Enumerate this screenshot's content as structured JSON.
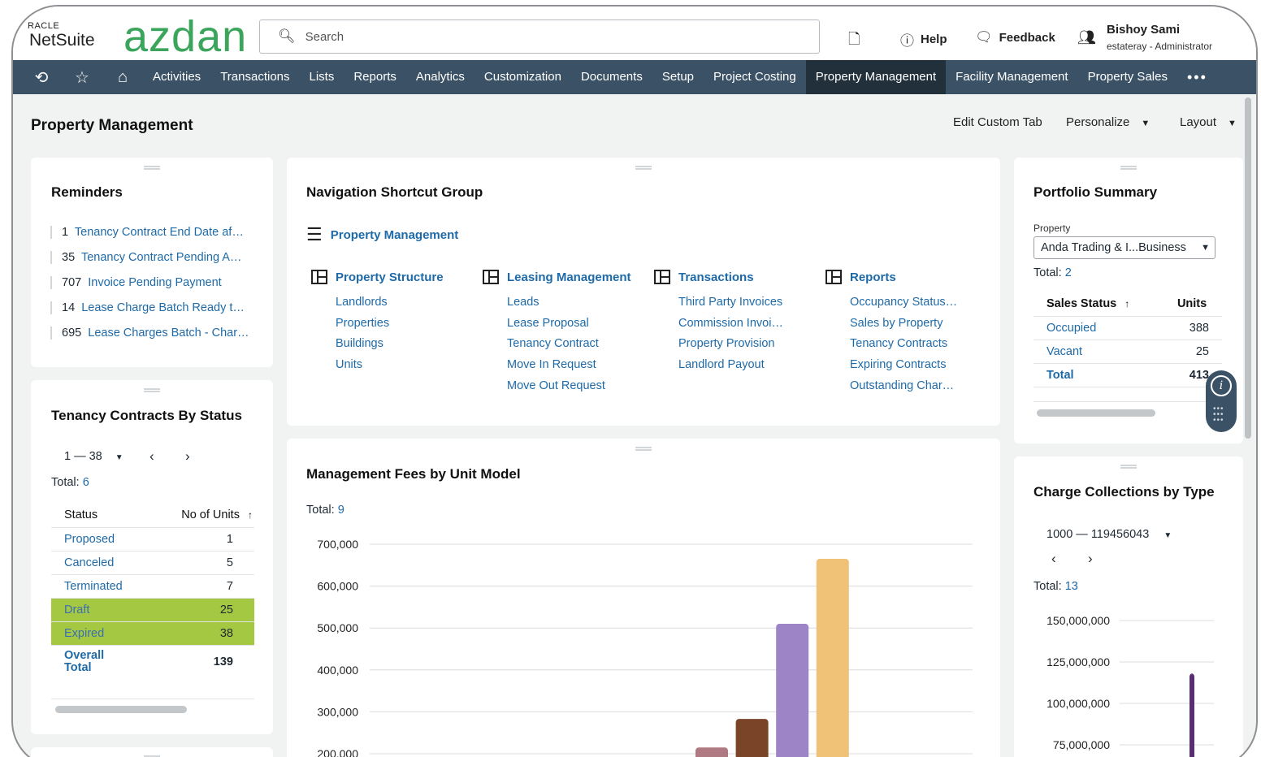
{
  "header": {
    "oracle_label": "RACLE",
    "netsuite_label": "NetSuite",
    "brand": "azdan",
    "search_placeholder": "Search",
    "help_label": "Help",
    "feedback_label": "Feedback",
    "user_name": "Bishoy Sami",
    "user_role": "estateray - Administrator"
  },
  "nav": {
    "items": [
      "Activities",
      "Transactions",
      "Lists",
      "Reports",
      "Analytics",
      "Customization",
      "Documents",
      "Setup",
      "Project Costing",
      "Property Management",
      "Facility Management",
      "Property Sales"
    ],
    "active": "Property Management",
    "more": "•••"
  },
  "page": {
    "title": "Property Management",
    "edit_custom_tab": "Edit Custom Tab",
    "personalize": "Personalize",
    "layout": "Layout"
  },
  "reminders": {
    "title": "Reminders",
    "items": [
      {
        "count": "1",
        "label": "Tenancy Contract End Date af…"
      },
      {
        "count": "35",
        "label": "Tenancy Contract Pending A…"
      },
      {
        "count": "707",
        "label": "Invoice Pending Payment"
      },
      {
        "count": "14",
        "label": "Lease Charge Batch Ready t…"
      },
      {
        "count": "695",
        "label": "Lease Charges Batch - Char…"
      }
    ]
  },
  "tenancy": {
    "title": "Tenancy Contracts By Status",
    "range": "1 — 38",
    "total_label": "Total:",
    "total_value": "6",
    "col_status": "Status",
    "col_units": "No of Units",
    "rows": [
      {
        "status": "Proposed",
        "units": "1"
      },
      {
        "status": "Canceled",
        "units": "5"
      },
      {
        "status": "Terminated",
        "units": "7"
      },
      {
        "status": "Draft",
        "units": "25"
      },
      {
        "status": "Expired",
        "units": "38"
      }
    ],
    "overall_label_1": "Overall",
    "overall_label_2": "Total",
    "overall_value": "139"
  },
  "nav_shortcuts": {
    "title": "Navigation Shortcut Group",
    "group_label": "Property Management",
    "columns": [
      {
        "header": "Property Structure",
        "links": [
          "Landlords",
          "Properties",
          "Buildings",
          "Units"
        ]
      },
      {
        "header": "Leasing Management",
        "links": [
          "Leads",
          "Lease Proposal",
          "Tenancy Contract",
          "Move In Request",
          "Move Out Request"
        ]
      },
      {
        "header": "Transactions",
        "links": [
          "Third Party Invoices",
          "Commission Invoi…",
          "Property Provision",
          "Landlord Payout"
        ]
      },
      {
        "header": "Reports",
        "links": [
          "Occupancy Status…",
          "Sales by Property",
          "Tenancy Contracts",
          "Expiring Contracts",
          "Outstanding Char…"
        ]
      }
    ]
  },
  "mgmt_fees": {
    "title": "Management Fees by Unit Model",
    "total_label": "Total:",
    "total_value": "9"
  },
  "portfolio": {
    "title": "Portfolio Summary",
    "property_label": "Property",
    "property_value": "Anda Trading & I...Business",
    "total_label": "Total:",
    "total_value": "2",
    "col_status": "Sales Status",
    "col_units": "Units",
    "rows": [
      {
        "status": "Occupied",
        "units": "388"
      },
      {
        "status": "Vacant",
        "units": "25"
      }
    ],
    "total_row_label": "Total",
    "total_row_value": "413"
  },
  "charge": {
    "title": "Charge Collections by Type",
    "range": "1000 — 119456043",
    "total_label": "Total:",
    "total_value": "13"
  },
  "colors": {
    "nav_bg": "#3b5266",
    "nav_active": "#22303c",
    "link": "#1e6aa8",
    "highlight": "#a5c842",
    "brand": "#3ca55c"
  },
  "chart_data": [
    {
      "type": "bar",
      "title": "Management Fees by Unit Model",
      "ylim": [
        200000,
        700000
      ],
      "yticks": [
        "700,000",
        "600,000",
        "500,000",
        "400,000",
        "300,000",
        "200,000"
      ],
      "values": [
        215000,
        283000,
        510000,
        665000
      ],
      "colors": [
        "#b07a82",
        "#7a4428",
        "#9c84c6",
        "#f0c278"
      ],
      "grid": true
    },
    {
      "type": "bar",
      "title": "Charge Collections by Type",
      "ylim": [
        75000000,
        150000000
      ],
      "yticks": [
        "150,000,000",
        "125,000,000",
        "100,000,000",
        "75,000,000"
      ],
      "values": [
        118000000
      ],
      "colors": [
        "#5a2d6e"
      ],
      "grid": true
    }
  ]
}
